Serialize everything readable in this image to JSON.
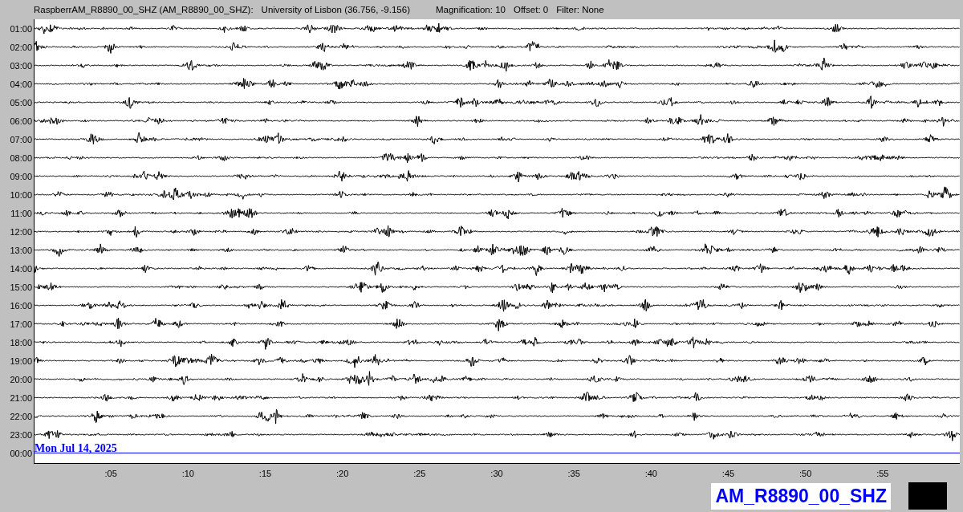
{
  "header": {
    "station": "RaspberrAM_R8890_00_SHZ (AM_R8890_00_SHZ):",
    "location": "University of Lisbon (36.756, -9.156)",
    "magnification": "Magnification: 10",
    "offset": "Offset: 0",
    "filter": "Filter: None"
  },
  "rows": [
    {
      "label": "01:00",
      "kind": "trace"
    },
    {
      "label": "02:00",
      "kind": "trace"
    },
    {
      "label": "03:00",
      "kind": "trace"
    },
    {
      "label": "04:00",
      "kind": "trace"
    },
    {
      "label": "05:00",
      "kind": "trace"
    },
    {
      "label": "06:00",
      "kind": "trace"
    },
    {
      "label": "07:00",
      "kind": "trace"
    },
    {
      "label": "08:00",
      "kind": "trace"
    },
    {
      "label": "09:00",
      "kind": "trace"
    },
    {
      "label": "10:00",
      "kind": "trace"
    },
    {
      "label": "11:00",
      "kind": "trace"
    },
    {
      "label": "12:00",
      "kind": "trace"
    },
    {
      "label": "13:00",
      "kind": "trace"
    },
    {
      "label": "14:00",
      "kind": "trace"
    },
    {
      "label": "15:00",
      "kind": "trace"
    },
    {
      "label": "16:00",
      "kind": "trace"
    },
    {
      "label": "17:00",
      "kind": "trace"
    },
    {
      "label": "18:00",
      "kind": "trace"
    },
    {
      "label": "19:00",
      "kind": "trace"
    },
    {
      "label": "20:00",
      "kind": "trace"
    },
    {
      "label": "21:00",
      "kind": "trace"
    },
    {
      "label": "22:00",
      "kind": "trace"
    },
    {
      "label": "23:00",
      "kind": "trace"
    },
    {
      "label": "00:00",
      "kind": "current",
      "date": "Mon Jul 14, 2025"
    }
  ],
  "x_ticks": [
    ":05",
    ":10",
    ":15",
    ":20",
    ":25",
    ":30",
    ":35",
    ":40",
    ":45",
    ":50",
    ":55"
  ],
  "station_label": "AM_R8890_00_SHZ"
}
